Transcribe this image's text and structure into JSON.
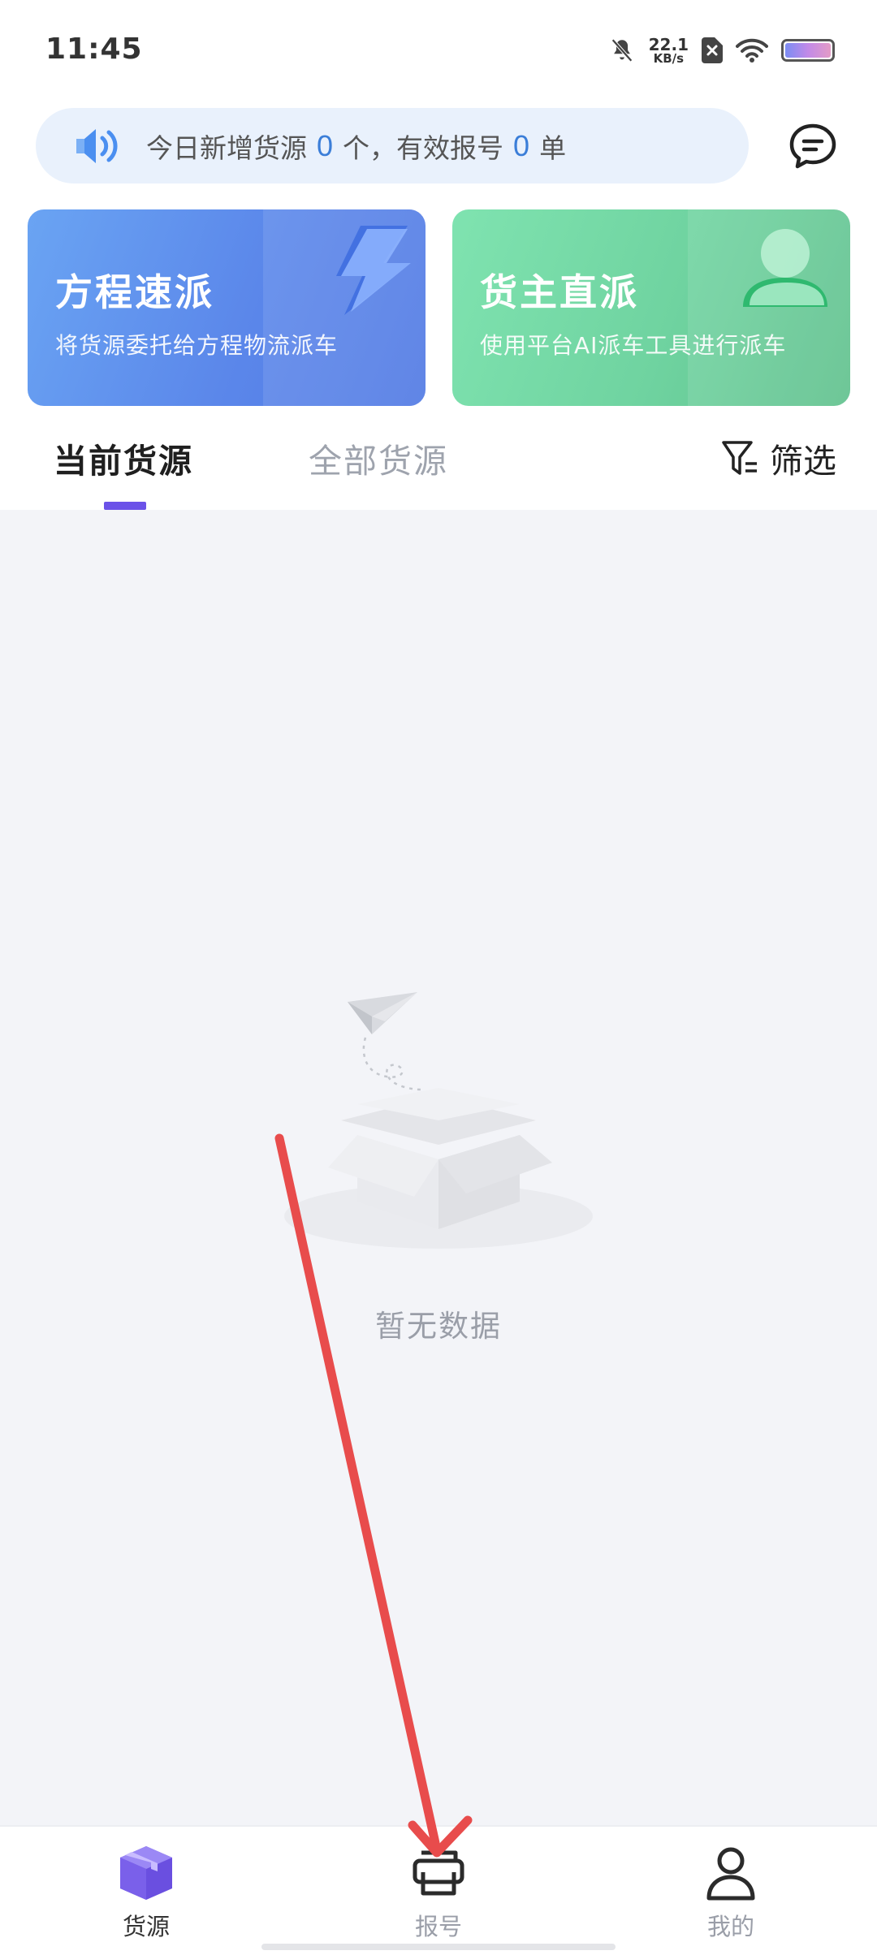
{
  "status_bar": {
    "time": "11:45",
    "net_speed_value": "22.1",
    "net_speed_unit": "KB/s",
    "icons": [
      "mute-bell-icon",
      "sim-off-icon",
      "wifi-icon",
      "battery-icon"
    ]
  },
  "notice": {
    "part1": "今日新增货源",
    "new_count": "0",
    "part2": "个，有效报号",
    "valid_count": "0",
    "part3": "单",
    "accent_color": "#3b7ed8"
  },
  "cards": [
    {
      "title": "方程速派",
      "subtitle": "将货源委托给方程物流派车",
      "color": "#5b87ea",
      "icon": "lightning-icon"
    },
    {
      "title": "货主直派",
      "subtitle": "使用平台AI派车工具进行派车",
      "color": "#6fd3a0",
      "icon": "person-icon"
    }
  ],
  "tabs": {
    "current": "当前货源",
    "all": "全部货源",
    "active_color": "#6b52e8"
  },
  "filter": {
    "label": "筛选"
  },
  "empty": {
    "text": "暂无数据"
  },
  "bottom_nav": [
    {
      "label": "货源",
      "icon": "box-icon",
      "active": true
    },
    {
      "label": "报号",
      "icon": "printer-icon",
      "active": false
    },
    {
      "label": "我的",
      "icon": "user-icon",
      "active": false
    }
  ],
  "annotation": {
    "color": "#e84c4c"
  }
}
